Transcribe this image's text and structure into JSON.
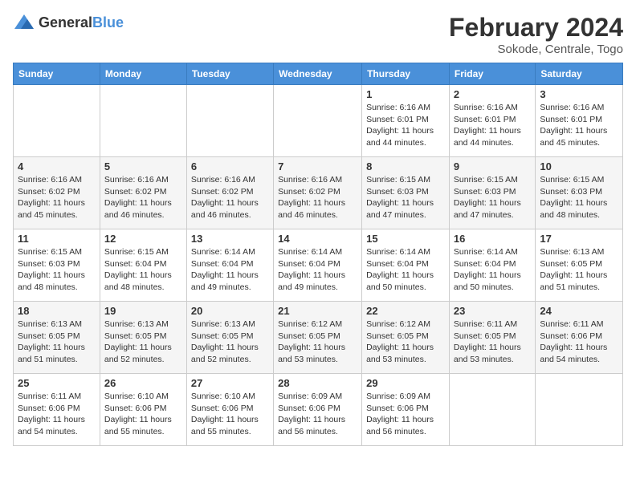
{
  "logo": {
    "text_general": "General",
    "text_blue": "Blue"
  },
  "title": "February 2024",
  "subtitle": "Sokode, Centrale, Togo",
  "days_of_week": [
    "Sunday",
    "Monday",
    "Tuesday",
    "Wednesday",
    "Thursday",
    "Friday",
    "Saturday"
  ],
  "weeks": [
    [
      {
        "num": "",
        "info": ""
      },
      {
        "num": "",
        "info": ""
      },
      {
        "num": "",
        "info": ""
      },
      {
        "num": "",
        "info": ""
      },
      {
        "num": "1",
        "info": "Sunrise: 6:16 AM\nSunset: 6:01 PM\nDaylight: 11 hours and 44 minutes."
      },
      {
        "num": "2",
        "info": "Sunrise: 6:16 AM\nSunset: 6:01 PM\nDaylight: 11 hours and 44 minutes."
      },
      {
        "num": "3",
        "info": "Sunrise: 6:16 AM\nSunset: 6:01 PM\nDaylight: 11 hours and 45 minutes."
      }
    ],
    [
      {
        "num": "4",
        "info": "Sunrise: 6:16 AM\nSunset: 6:02 PM\nDaylight: 11 hours and 45 minutes."
      },
      {
        "num": "5",
        "info": "Sunrise: 6:16 AM\nSunset: 6:02 PM\nDaylight: 11 hours and 46 minutes."
      },
      {
        "num": "6",
        "info": "Sunrise: 6:16 AM\nSunset: 6:02 PM\nDaylight: 11 hours and 46 minutes."
      },
      {
        "num": "7",
        "info": "Sunrise: 6:16 AM\nSunset: 6:02 PM\nDaylight: 11 hours and 46 minutes."
      },
      {
        "num": "8",
        "info": "Sunrise: 6:15 AM\nSunset: 6:03 PM\nDaylight: 11 hours and 47 minutes."
      },
      {
        "num": "9",
        "info": "Sunrise: 6:15 AM\nSunset: 6:03 PM\nDaylight: 11 hours and 47 minutes."
      },
      {
        "num": "10",
        "info": "Sunrise: 6:15 AM\nSunset: 6:03 PM\nDaylight: 11 hours and 48 minutes."
      }
    ],
    [
      {
        "num": "11",
        "info": "Sunrise: 6:15 AM\nSunset: 6:03 PM\nDaylight: 11 hours and 48 minutes."
      },
      {
        "num": "12",
        "info": "Sunrise: 6:15 AM\nSunset: 6:04 PM\nDaylight: 11 hours and 48 minutes."
      },
      {
        "num": "13",
        "info": "Sunrise: 6:14 AM\nSunset: 6:04 PM\nDaylight: 11 hours and 49 minutes."
      },
      {
        "num": "14",
        "info": "Sunrise: 6:14 AM\nSunset: 6:04 PM\nDaylight: 11 hours and 49 minutes."
      },
      {
        "num": "15",
        "info": "Sunrise: 6:14 AM\nSunset: 6:04 PM\nDaylight: 11 hours and 50 minutes."
      },
      {
        "num": "16",
        "info": "Sunrise: 6:14 AM\nSunset: 6:04 PM\nDaylight: 11 hours and 50 minutes."
      },
      {
        "num": "17",
        "info": "Sunrise: 6:13 AM\nSunset: 6:05 PM\nDaylight: 11 hours and 51 minutes."
      }
    ],
    [
      {
        "num": "18",
        "info": "Sunrise: 6:13 AM\nSunset: 6:05 PM\nDaylight: 11 hours and 51 minutes."
      },
      {
        "num": "19",
        "info": "Sunrise: 6:13 AM\nSunset: 6:05 PM\nDaylight: 11 hours and 52 minutes."
      },
      {
        "num": "20",
        "info": "Sunrise: 6:13 AM\nSunset: 6:05 PM\nDaylight: 11 hours and 52 minutes."
      },
      {
        "num": "21",
        "info": "Sunrise: 6:12 AM\nSunset: 6:05 PM\nDaylight: 11 hours and 53 minutes."
      },
      {
        "num": "22",
        "info": "Sunrise: 6:12 AM\nSunset: 6:05 PM\nDaylight: 11 hours and 53 minutes."
      },
      {
        "num": "23",
        "info": "Sunrise: 6:11 AM\nSunset: 6:05 PM\nDaylight: 11 hours and 53 minutes."
      },
      {
        "num": "24",
        "info": "Sunrise: 6:11 AM\nSunset: 6:06 PM\nDaylight: 11 hours and 54 minutes."
      }
    ],
    [
      {
        "num": "25",
        "info": "Sunrise: 6:11 AM\nSunset: 6:06 PM\nDaylight: 11 hours and 54 minutes."
      },
      {
        "num": "26",
        "info": "Sunrise: 6:10 AM\nSunset: 6:06 PM\nDaylight: 11 hours and 55 minutes."
      },
      {
        "num": "27",
        "info": "Sunrise: 6:10 AM\nSunset: 6:06 PM\nDaylight: 11 hours and 55 minutes."
      },
      {
        "num": "28",
        "info": "Sunrise: 6:09 AM\nSunset: 6:06 PM\nDaylight: 11 hours and 56 minutes."
      },
      {
        "num": "29",
        "info": "Sunrise: 6:09 AM\nSunset: 6:06 PM\nDaylight: 11 hours and 56 minutes."
      },
      {
        "num": "",
        "info": ""
      },
      {
        "num": "",
        "info": ""
      }
    ]
  ]
}
